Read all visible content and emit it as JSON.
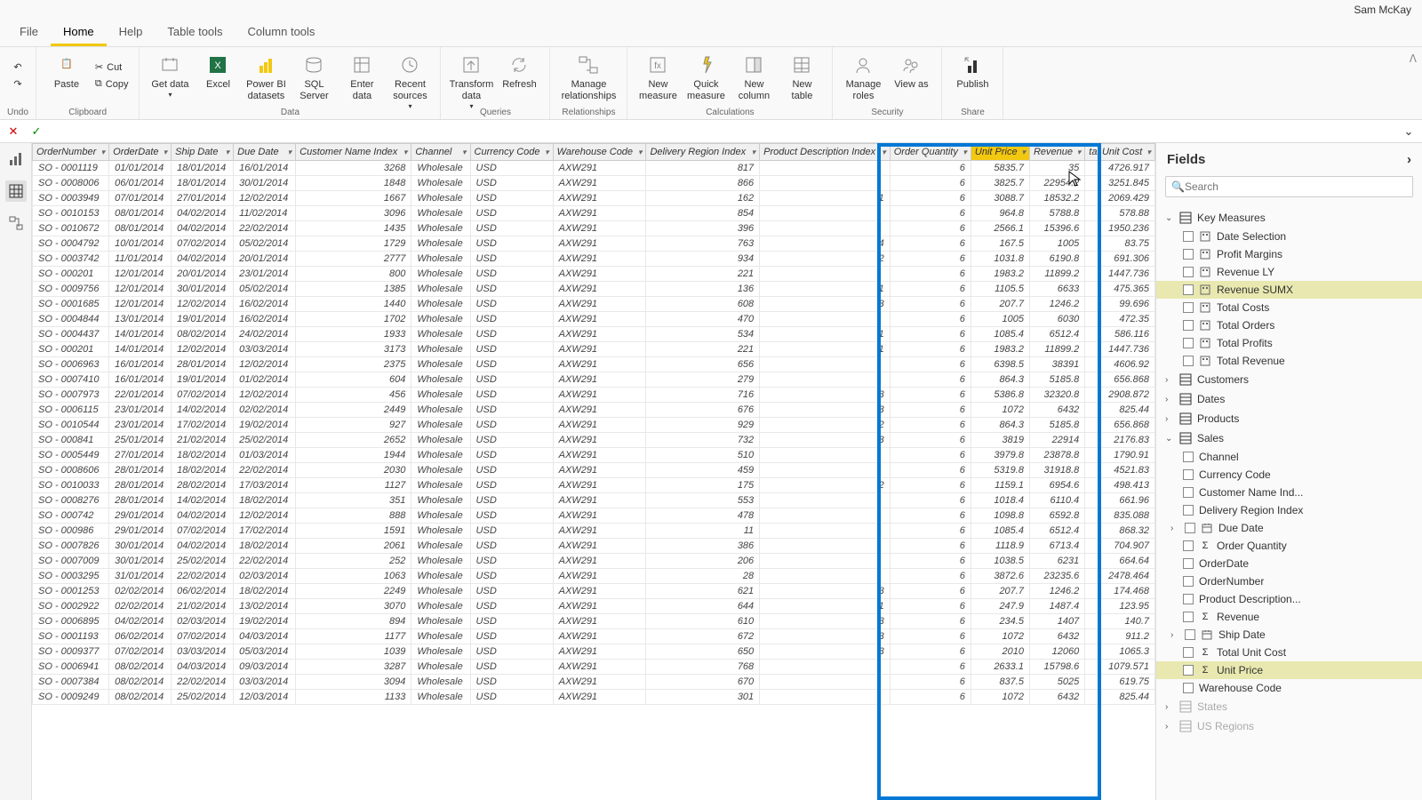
{
  "user": "Sam McKay",
  "tabs": {
    "file": "File",
    "home": "Home",
    "help": "Help",
    "tabletools": "Table tools",
    "coltools": "Column tools"
  },
  "ribbon": {
    "undo": {
      "label": "Undo"
    },
    "clipboard": {
      "label": "Clipboard",
      "paste": "Paste",
      "cut": "Cut",
      "copy": "Copy"
    },
    "data": {
      "label": "Data",
      "get": "Get data",
      "excel": "Excel",
      "pbids": "Power BI datasets",
      "sql": "SQL Server",
      "enter": "Enter data",
      "recent": "Recent sources"
    },
    "queries": {
      "label": "Queries",
      "transform": "Transform data",
      "refresh": "Refresh"
    },
    "rel": {
      "label": "Relationships",
      "manage": "Manage relationships"
    },
    "calc": {
      "label": "Calculations",
      "newm": "New measure",
      "quick": "Quick measure",
      "newc": "New column",
      "newt": "New table"
    },
    "sec": {
      "label": "Security",
      "roles": "Manage roles",
      "view": "View as"
    },
    "share": {
      "label": "Share",
      "publish": "Publish"
    }
  },
  "columns": [
    "OrderNumber",
    "OrderDate",
    "Ship Date",
    "Due Date",
    "Customer Name Index",
    "Channel",
    "Currency Code",
    "Warehouse Code",
    "Delivery Region Index",
    "Product Description Index",
    "Order Quantity",
    "Unit Price",
    "Revenue",
    "tal Unit Cost"
  ],
  "rows": [
    [
      "SO - 0001119",
      "01/01/2014",
      "18/01/2014",
      "16/01/2014",
      "3268",
      "Wholesale",
      "USD",
      "AXW291",
      "817",
      "",
      "6",
      "5835.7",
      "35",
      "4726.917"
    ],
    [
      "SO - 0008006",
      "06/01/2014",
      "18/01/2014",
      "30/01/2014",
      "1848",
      "Wholesale",
      "USD",
      "AXW291",
      "866",
      "",
      "6",
      "3825.7",
      "22954.2",
      "3251.845"
    ],
    [
      "SO - 0003949",
      "07/01/2014",
      "27/01/2014",
      "12/02/2014",
      "1667",
      "Wholesale",
      "USD",
      "AXW291",
      "162",
      "1",
      "6",
      "3088.7",
      "18532.2",
      "2069.429"
    ],
    [
      "SO - 0010153",
      "08/01/2014",
      "04/02/2014",
      "11/02/2014",
      "3096",
      "Wholesale",
      "USD",
      "AXW291",
      "854",
      "",
      "6",
      "964.8",
      "5788.8",
      "578.88"
    ],
    [
      "SO - 0010672",
      "08/01/2014",
      "04/02/2014",
      "22/02/2014",
      "1435",
      "Wholesale",
      "USD",
      "AXW291",
      "396",
      "",
      "6",
      "2566.1",
      "15396.6",
      "1950.236"
    ],
    [
      "SO - 0004792",
      "10/01/2014",
      "07/02/2014",
      "05/02/2014",
      "1729",
      "Wholesale",
      "USD",
      "AXW291",
      "763",
      "4",
      "6",
      "167.5",
      "1005",
      "83.75"
    ],
    [
      "SO - 0003742",
      "11/01/2014",
      "04/02/2014",
      "20/01/2014",
      "2777",
      "Wholesale",
      "USD",
      "AXW291",
      "934",
      "2",
      "6",
      "1031.8",
      "6190.8",
      "691.306"
    ],
    [
      "SO - 000201",
      "12/01/2014",
      "20/01/2014",
      "23/01/2014",
      "800",
      "Wholesale",
      "USD",
      "AXW291",
      "221",
      "",
      "6",
      "1983.2",
      "11899.2",
      "1447.736"
    ],
    [
      "SO - 0009756",
      "12/01/2014",
      "30/01/2014",
      "05/02/2014",
      "1385",
      "Wholesale",
      "USD",
      "AXW291",
      "136",
      "1",
      "6",
      "1105.5",
      "6633",
      "475.365"
    ],
    [
      "SO - 0001685",
      "12/01/2014",
      "12/02/2014",
      "16/02/2014",
      "1440",
      "Wholesale",
      "USD",
      "AXW291",
      "608",
      "3",
      "6",
      "207.7",
      "1246.2",
      "99.696"
    ],
    [
      "SO - 0004844",
      "13/01/2014",
      "19/01/2014",
      "16/02/2014",
      "1702",
      "Wholesale",
      "USD",
      "AXW291",
      "470",
      "",
      "6",
      "1005",
      "6030",
      "472.35"
    ],
    [
      "SO - 0004437",
      "14/01/2014",
      "08/02/2014",
      "24/02/2014",
      "1933",
      "Wholesale",
      "USD",
      "AXW291",
      "534",
      "1",
      "6",
      "1085.4",
      "6512.4",
      "586.116"
    ],
    [
      "SO - 000201",
      "14/01/2014",
      "12/02/2014",
      "03/03/2014",
      "3173",
      "Wholesale",
      "USD",
      "AXW291",
      "221",
      "1",
      "6",
      "1983.2",
      "11899.2",
      "1447.736"
    ],
    [
      "SO - 0006963",
      "16/01/2014",
      "28/01/2014",
      "12/02/2014",
      "2375",
      "Wholesale",
      "USD",
      "AXW291",
      "656",
      "",
      "6",
      "6398.5",
      "38391",
      "4606.92"
    ],
    [
      "SO - 0007410",
      "16/01/2014",
      "19/01/2014",
      "01/02/2014",
      "604",
      "Wholesale",
      "USD",
      "AXW291",
      "279",
      "",
      "6",
      "864.3",
      "5185.8",
      "656.868"
    ],
    [
      "SO - 0007973",
      "22/01/2014",
      "07/02/2014",
      "12/02/2014",
      "456",
      "Wholesale",
      "USD",
      "AXW291",
      "716",
      "3",
      "6",
      "5386.8",
      "32320.8",
      "2908.872"
    ],
    [
      "SO - 0006115",
      "23/01/2014",
      "14/02/2014",
      "02/02/2014",
      "2449",
      "Wholesale",
      "USD",
      "AXW291",
      "676",
      "3",
      "6",
      "1072",
      "6432",
      "825.44"
    ],
    [
      "SO - 0010544",
      "23/01/2014",
      "17/02/2014",
      "19/02/2014",
      "927",
      "Wholesale",
      "USD",
      "AXW291",
      "929",
      "2",
      "6",
      "864.3",
      "5185.8",
      "656.868"
    ],
    [
      "SO - 000841",
      "25/01/2014",
      "21/02/2014",
      "25/02/2014",
      "2652",
      "Wholesale",
      "USD",
      "AXW291",
      "732",
      "3",
      "6",
      "3819",
      "22914",
      "2176.83"
    ],
    [
      "SO - 0005449",
      "27/01/2014",
      "18/02/2014",
      "01/03/2014",
      "1944",
      "Wholesale",
      "USD",
      "AXW291",
      "510",
      "",
      "6",
      "3979.8",
      "23878.8",
      "1790.91"
    ],
    [
      "SO - 0008606",
      "28/01/2014",
      "18/02/2014",
      "22/02/2014",
      "2030",
      "Wholesale",
      "USD",
      "AXW291",
      "459",
      "",
      "6",
      "5319.8",
      "31918.8",
      "4521.83"
    ],
    [
      "SO - 0010033",
      "28/01/2014",
      "28/02/2014",
      "17/03/2014",
      "1127",
      "Wholesale",
      "USD",
      "AXW291",
      "175",
      "2",
      "6",
      "1159.1",
      "6954.6",
      "498.413"
    ],
    [
      "SO - 0008276",
      "28/01/2014",
      "14/02/2014",
      "18/02/2014",
      "351",
      "Wholesale",
      "USD",
      "AXW291",
      "553",
      "",
      "6",
      "1018.4",
      "6110.4",
      "661.96"
    ],
    [
      "SO - 000742",
      "29/01/2014",
      "04/02/2014",
      "12/02/2014",
      "888",
      "Wholesale",
      "USD",
      "AXW291",
      "478",
      "",
      "6",
      "1098.8",
      "6592.8",
      "835.088"
    ],
    [
      "SO - 000986",
      "29/01/2014",
      "07/02/2014",
      "17/02/2014",
      "1591",
      "Wholesale",
      "USD",
      "AXW291",
      "11",
      "",
      "6",
      "1085.4",
      "6512.4",
      "868.32"
    ],
    [
      "SO - 0007826",
      "30/01/2014",
      "04/02/2014",
      "18/02/2014",
      "2061",
      "Wholesale",
      "USD",
      "AXW291",
      "386",
      "",
      "6",
      "1118.9",
      "6713.4",
      "704.907"
    ],
    [
      "SO - 0007009",
      "30/01/2014",
      "25/02/2014",
      "22/02/2014",
      "252",
      "Wholesale",
      "USD",
      "AXW291",
      "206",
      "",
      "6",
      "1038.5",
      "6231",
      "664.64"
    ],
    [
      "SO - 0003295",
      "31/01/2014",
      "22/02/2014",
      "02/03/2014",
      "1063",
      "Wholesale",
      "USD",
      "AXW291",
      "28",
      "",
      "6",
      "3872.6",
      "23235.6",
      "2478.464"
    ],
    [
      "SO - 0001253",
      "02/02/2014",
      "06/02/2014",
      "18/02/2014",
      "2249",
      "Wholesale",
      "USD",
      "AXW291",
      "621",
      "3",
      "6",
      "207.7",
      "1246.2",
      "174.468"
    ],
    [
      "SO - 0002922",
      "02/02/2014",
      "21/02/2014",
      "13/02/2014",
      "3070",
      "Wholesale",
      "USD",
      "AXW291",
      "644",
      "1",
      "6",
      "247.9",
      "1487.4",
      "123.95"
    ],
    [
      "SO - 0006895",
      "04/02/2014",
      "02/03/2014",
      "19/02/2014",
      "894",
      "Wholesale",
      "USD",
      "AXW291",
      "610",
      "3",
      "6",
      "234.5",
      "1407",
      "140.7"
    ],
    [
      "SO - 0001193",
      "06/02/2014",
      "07/02/2014",
      "04/03/2014",
      "1177",
      "Wholesale",
      "USD",
      "AXW291",
      "672",
      "3",
      "6",
      "1072",
      "6432",
      "911.2"
    ],
    [
      "SO - 0009377",
      "07/02/2014",
      "03/03/2014",
      "05/03/2014",
      "1039",
      "Wholesale",
      "USD",
      "AXW291",
      "650",
      "3",
      "6",
      "2010",
      "12060",
      "1065.3"
    ],
    [
      "SO - 0006941",
      "08/02/2014",
      "04/03/2014",
      "09/03/2014",
      "3287",
      "Wholesale",
      "USD",
      "AXW291",
      "768",
      "",
      "6",
      "2633.1",
      "15798.6",
      "1079.571"
    ],
    [
      "SO - 0007384",
      "08/02/2014",
      "22/02/2014",
      "03/03/2014",
      "3094",
      "Wholesale",
      "USD",
      "AXW291",
      "670",
      "",
      "6",
      "837.5",
      "5025",
      "619.75"
    ],
    [
      "SO - 0009249",
      "08/02/2014",
      "25/02/2014",
      "12/03/2014",
      "1133",
      "Wholesale",
      "USD",
      "AXW291",
      "301",
      "",
      "6",
      "1072",
      "6432",
      "825.44"
    ]
  ],
  "fields": {
    "title": "Fields",
    "search": "Search",
    "groups": [
      {
        "name": "Key Measures",
        "open": true,
        "items": [
          {
            "label": "Date Selection",
            "type": "m"
          },
          {
            "label": "Profit Margins",
            "type": "m"
          },
          {
            "label": "Revenue LY",
            "type": "m"
          },
          {
            "label": "Revenue SUMX",
            "type": "m",
            "sel": true
          },
          {
            "label": "Total Costs",
            "type": "m"
          },
          {
            "label": "Total Orders",
            "type": "m"
          },
          {
            "label": "Total Profits",
            "type": "m"
          },
          {
            "label": "Total Revenue",
            "type": "m"
          }
        ]
      },
      {
        "name": "Customers",
        "open": false
      },
      {
        "name": "Dates",
        "open": false
      },
      {
        "name": "Products",
        "open": false
      },
      {
        "name": "Sales",
        "open": true,
        "items": [
          {
            "label": "Channel"
          },
          {
            "label": "Currency Code"
          },
          {
            "label": "Customer Name Ind..."
          },
          {
            "label": "Delivery Region Index"
          },
          {
            "label": "Due Date",
            "type": "d",
            "exp": true
          },
          {
            "label": "Order Quantity",
            "type": "s"
          },
          {
            "label": "OrderDate"
          },
          {
            "label": "OrderNumber"
          },
          {
            "label": "Product Description..."
          },
          {
            "label": "Revenue",
            "type": "s"
          },
          {
            "label": "Ship Date",
            "type": "d",
            "exp": true
          },
          {
            "label": "Total Unit Cost",
            "type": "s"
          },
          {
            "label": "Unit Price",
            "type": "s",
            "sel": true
          },
          {
            "label": "Warehouse Code"
          }
        ]
      },
      {
        "name": "States",
        "open": false,
        "dim": true
      },
      {
        "name": "US Regions",
        "open": false,
        "dim": true
      }
    ]
  }
}
